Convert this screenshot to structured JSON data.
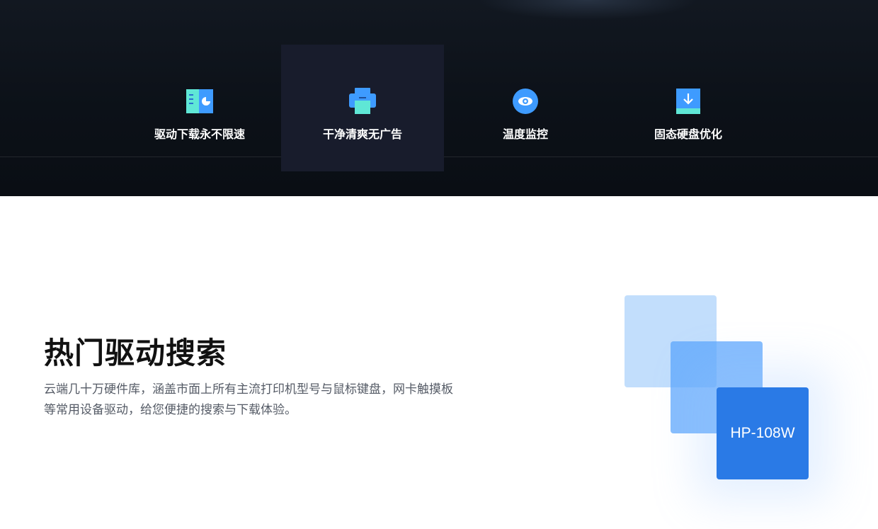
{
  "features": [
    {
      "label": "驱动下载永不限速",
      "icon": "book-chart-icon"
    },
    {
      "label": "干净清爽无广告",
      "icon": "printer-icon"
    },
    {
      "label": "温度监控",
      "icon": "eye-icon"
    },
    {
      "label": "固态硬盘优化",
      "icon": "download-box-icon"
    }
  ],
  "section": {
    "title": "热门驱动搜索",
    "description_line1": "云端几十万硬件库，涵盖市面上所有主流打印机型号与鼠标键盘，网卡触摸板",
    "description_line2": "等常用设备驱动，给您便捷的搜索与下载体验。"
  },
  "showcase": {
    "card_label": "HP-108W"
  },
  "colors": {
    "hero_bg": "#0c1118",
    "accent_blue": "#2a7ae6",
    "icon_cyan": "#5fe7d6",
    "icon_blue": "#3e9bff"
  }
}
